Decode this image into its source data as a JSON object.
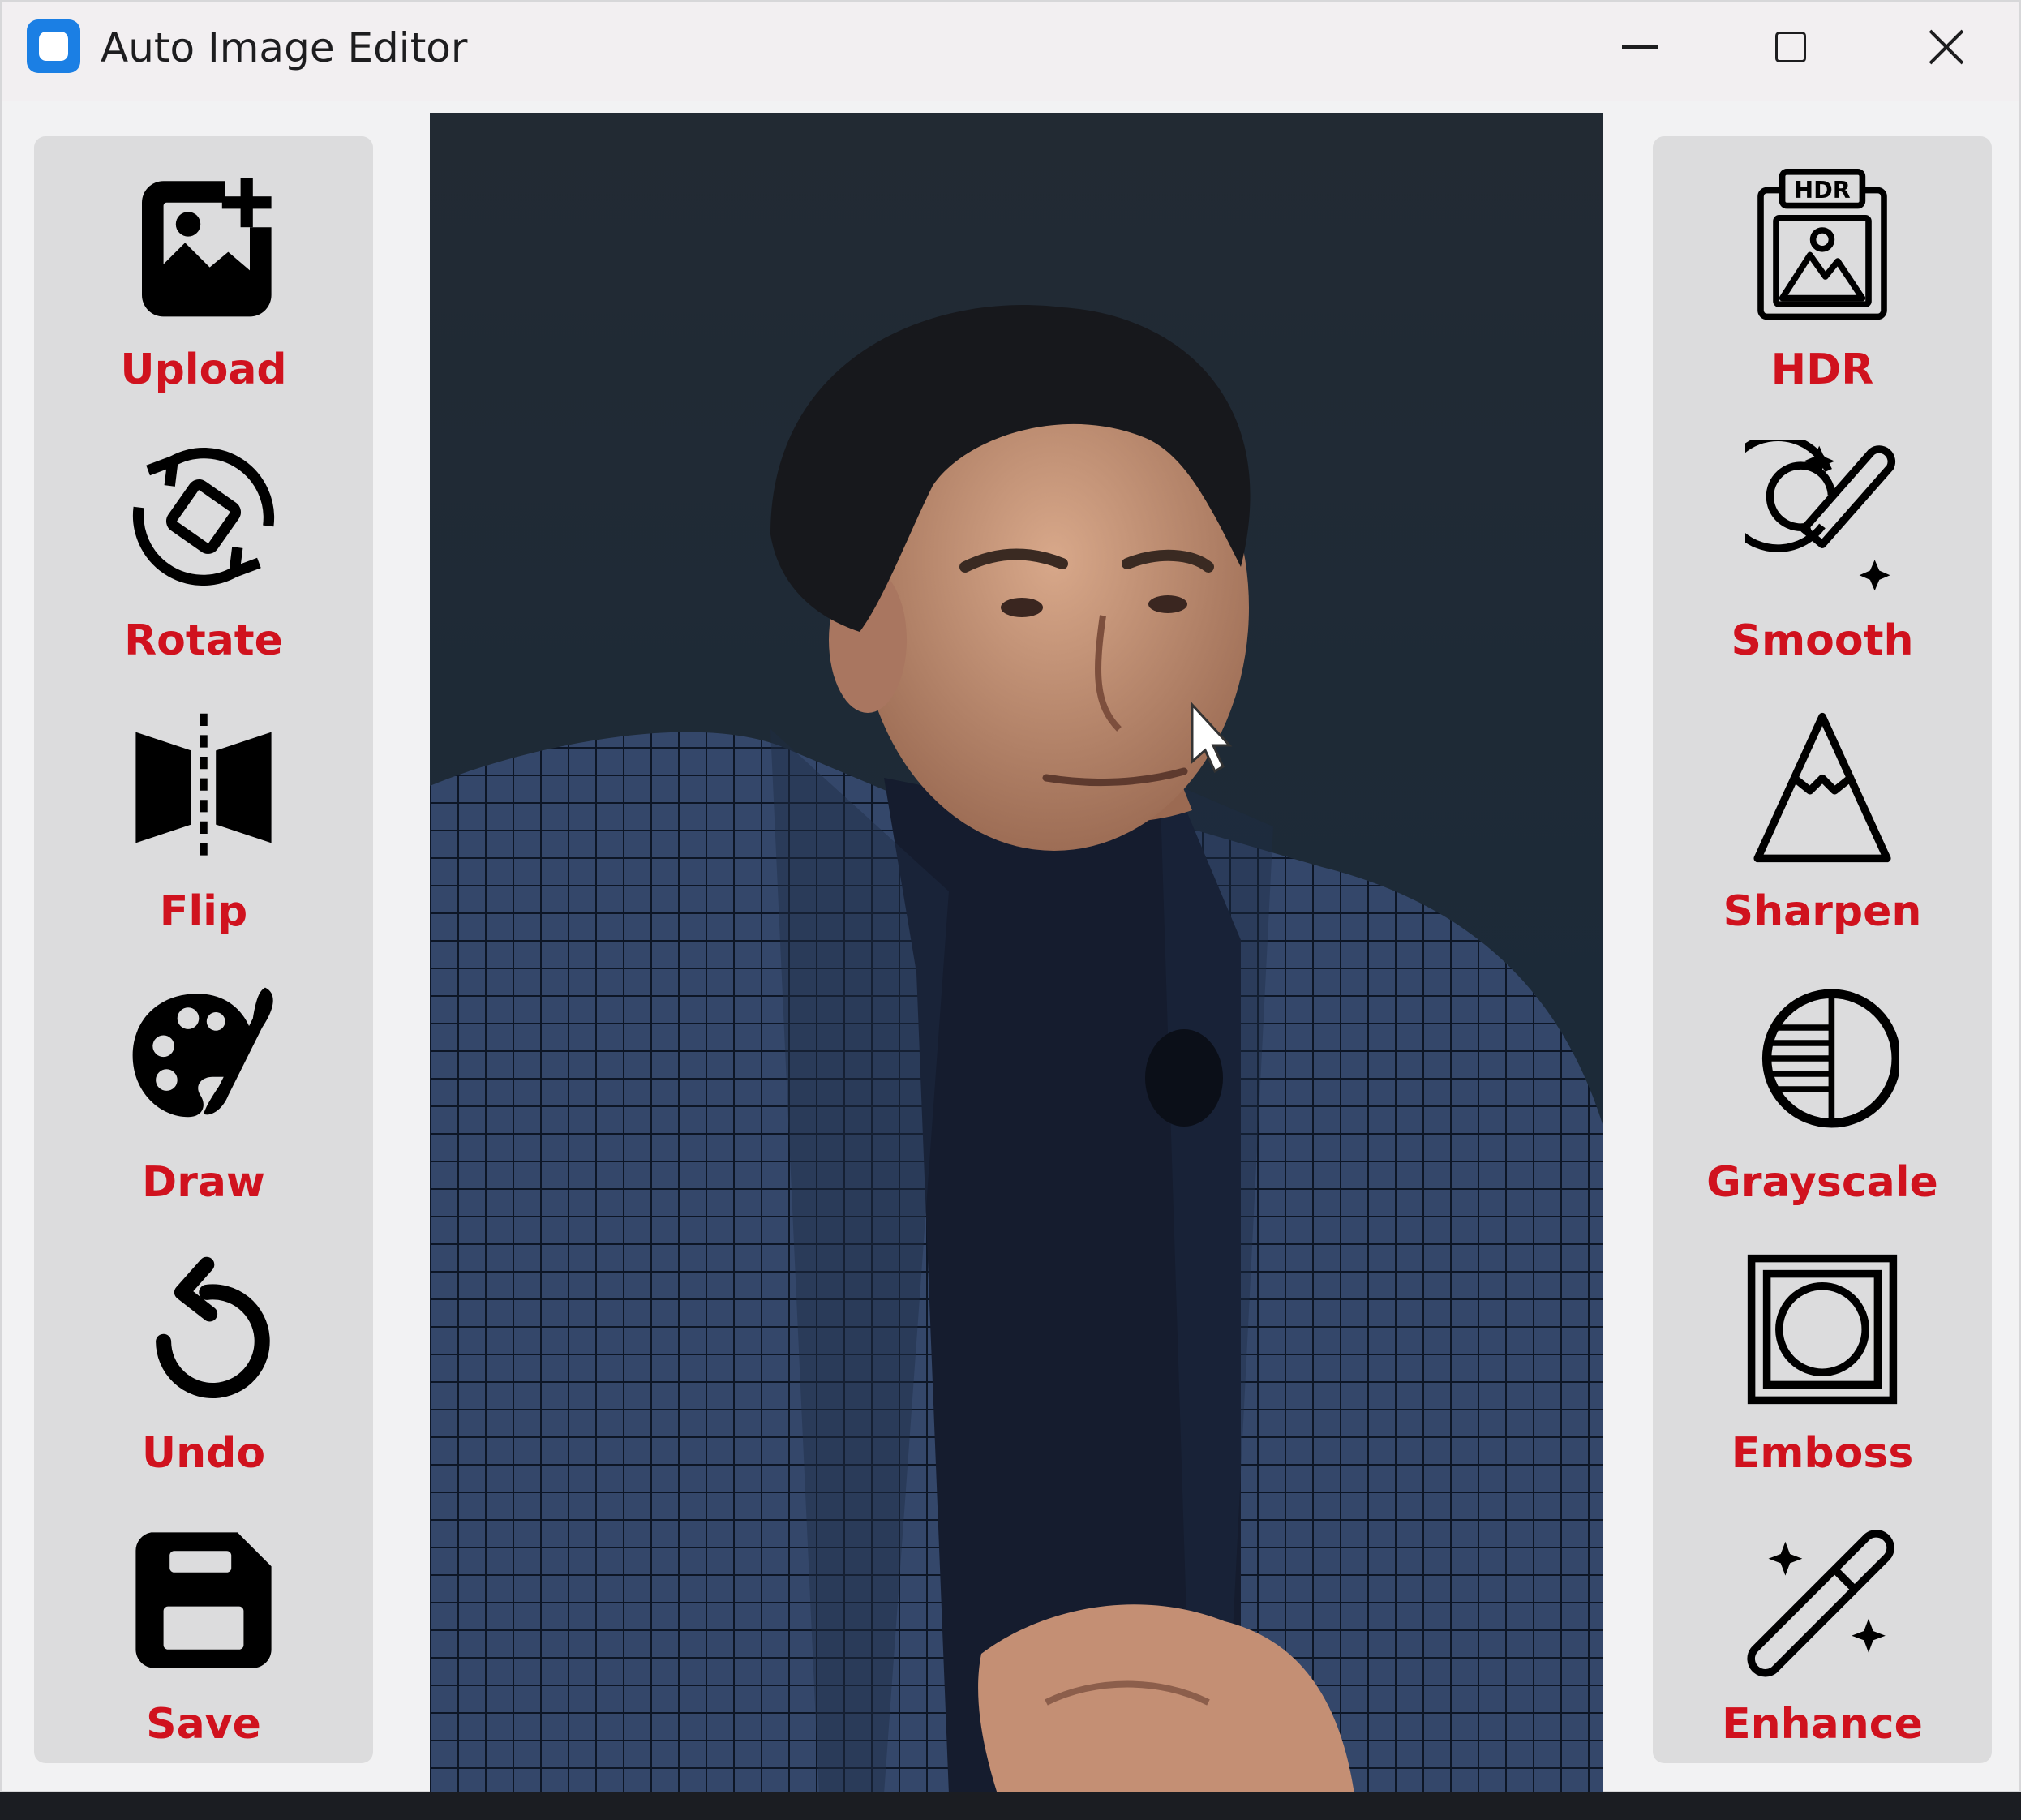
{
  "window": {
    "title": "Auto Image Editor",
    "colors": {
      "label": "#d0121e",
      "icon": "#000000",
      "panel": "#dcdcdd",
      "app_icon": "#1b7fe4"
    }
  },
  "left_tools": [
    {
      "label": "Upload",
      "icon": "add-image-icon"
    },
    {
      "label": "Rotate",
      "icon": "rotate-icon"
    },
    {
      "label": "Flip",
      "icon": "flip-icon"
    },
    {
      "label": "Draw",
      "icon": "palette-brush-icon"
    },
    {
      "label": "Undo",
      "icon": "undo-icon"
    },
    {
      "label": "Save",
      "icon": "save-icon"
    }
  ],
  "right_tools": [
    {
      "label": "HDR",
      "icon": "hdr-image-icon",
      "icon_text": "HDR"
    },
    {
      "label": "Smooth",
      "icon": "smooth-brush-icon"
    },
    {
      "label": "Sharpen",
      "icon": "mountain-peak-icon"
    },
    {
      "label": "Grayscale",
      "icon": "half-circle-icon"
    },
    {
      "label": "Emboss",
      "icon": "emboss-frame-icon"
    },
    {
      "label": "Enhance",
      "icon": "magic-wand-icon"
    }
  ],
  "canvas": {
    "content": "portrait-photo"
  }
}
